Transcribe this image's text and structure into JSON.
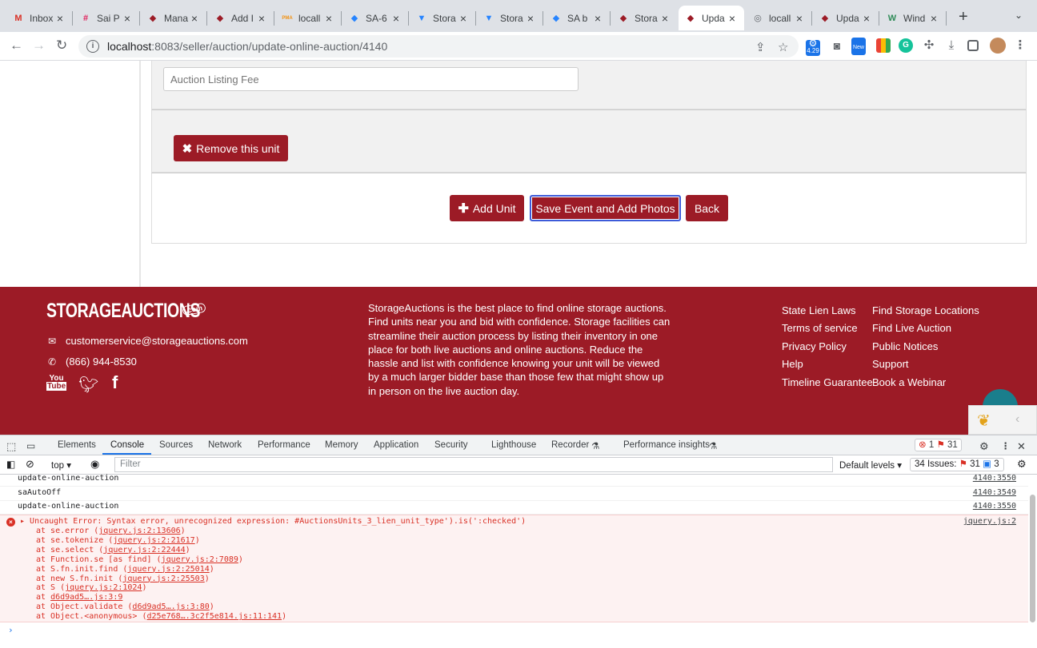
{
  "browser": {
    "tabs": [
      {
        "title": "Inbox",
        "icon": "gmail-icon",
        "color": "#d93025",
        "glyph": "M"
      },
      {
        "title": "Sai P",
        "icon": "slack-icon",
        "color": "#e01e5a",
        "glyph": "#"
      },
      {
        "title": "Mana",
        "icon": "tag-icon",
        "color": "#9c1b26",
        "glyph": "◆"
      },
      {
        "title": "Add I",
        "icon": "tag-icon",
        "color": "#9c1b26",
        "glyph": "◆"
      },
      {
        "title": "locall",
        "icon": "phpmyadmin-icon",
        "color": "#f29111",
        "glyph": "PMA"
      },
      {
        "title": "SA-6",
        "icon": "jira-icon",
        "color": "#2684ff",
        "glyph": "◆"
      },
      {
        "title": "Stora",
        "icon": "bitbucket-icon",
        "color": "#2684ff",
        "glyph": "▼"
      },
      {
        "title": "Stora",
        "icon": "bitbucket-icon",
        "color": "#2684ff",
        "glyph": "▼"
      },
      {
        "title": "SA b",
        "icon": "jira-icon",
        "color": "#2684ff",
        "glyph": "◆"
      },
      {
        "title": "Stora",
        "icon": "tag-icon",
        "color": "#9c1b26",
        "glyph": "◆"
      },
      {
        "title": "Upda",
        "icon": "tag-icon",
        "color": "#9c1b26",
        "glyph": "◆",
        "active": true
      },
      {
        "title": "locall",
        "icon": "globe-icon",
        "color": "#5f6368",
        "glyph": "◎"
      },
      {
        "title": "Upda",
        "icon": "tag-icon",
        "color": "#9c1b26",
        "glyph": "◆"
      },
      {
        "title": "Wind",
        "icon": "windsurf-icon",
        "color": "#2e8b57",
        "glyph": "W"
      }
    ],
    "url_host": "localhost",
    "url_rest": ":8083/seller/auction/update-online-auction/4140",
    "ext_badge_1": "4.29",
    "ext_badge_2": "New"
  },
  "form": {
    "fee_placeholder": "Auction Listing Fee",
    "remove_unit_label": "Remove this unit",
    "add_unit_label": "Add Unit",
    "save_label": "Save Event and Add Photos",
    "back_label": "Back"
  },
  "footer": {
    "logo": "STORAGEAUCTIONS",
    "logo_suffix": ".com",
    "email": "customerservice@storageauctions.com",
    "phone": "(866) 944-8530",
    "about": "StorageAuctions is the best place to find online storage auctions. Find units near you and bid with confidence. Storage facilities can streamline their auction process by listing their inventory in one place for both live auctions and online auctions. Reduce the hassle and list with confidence knowing your unit will be viewed by a much larger bidder base than those few that might show up in person on the live auction day.",
    "links_col1": [
      "State Lien Laws",
      "Terms of service",
      "Privacy Policy",
      "Help",
      "Timeline Guarantee"
    ],
    "links_col2": [
      "Find Storage Locations",
      "Find Live Auction",
      "Public Notices",
      "Support",
      "Book a Webinar"
    ]
  },
  "devtools": {
    "tabs": [
      "Elements",
      "Console",
      "Sources",
      "Network",
      "Performance",
      "Memory",
      "Application",
      "Security",
      "Lighthouse",
      "Recorder",
      "Performance insights"
    ],
    "error_count": "1",
    "warning_count": "31",
    "context": "top",
    "filter_placeholder": "Filter",
    "levels": "Default levels",
    "issues_label": "34 Issues:",
    "issues_errors": "31",
    "issues_info": "3",
    "console_lines": [
      {
        "text": "update-online-auction",
        "src": "4140:3550"
      },
      {
        "text": "saAutoOff",
        "src": "4140:3549"
      },
      {
        "text": "update-online-auction",
        "src": "4140:3550"
      }
    ],
    "error_message": "Uncaught Error: Syntax error, unrecognized expression: #AuctionsUnits_3_lien_unit_type').is(':checked')",
    "error_src": "jquery.js:2",
    "stack": [
      {
        "pre": "at se.error (",
        "link": "jquery.js:2:13606",
        "post": ")"
      },
      {
        "pre": "at se.tokenize (",
        "link": "jquery.js:2:21617",
        "post": ")"
      },
      {
        "pre": "at se.select (",
        "link": "jquery.js:2:22444",
        "post": ")"
      },
      {
        "pre": "at Function.se [as find] (",
        "link": "jquery.js:2:7089",
        "post": ")"
      },
      {
        "pre": "at S.fn.init.find (",
        "link": "jquery.js:2:25014",
        "post": ")"
      },
      {
        "pre": "at new S.fn.init (",
        "link": "jquery.js:2:25503",
        "post": ")"
      },
      {
        "pre": "at S (",
        "link": "jquery.js:2:1024",
        "post": ")"
      },
      {
        "pre": "at ",
        "link": "d6d9ad5….js:3:9",
        "post": ""
      },
      {
        "pre": "at Object.validate (",
        "link": "d6d9ad5….js:3:80",
        "post": ")"
      },
      {
        "pre": "at Object.<anonymous> (",
        "link": "d25e768….3c2f5e814.js:11:141",
        "post": ")"
      }
    ]
  }
}
